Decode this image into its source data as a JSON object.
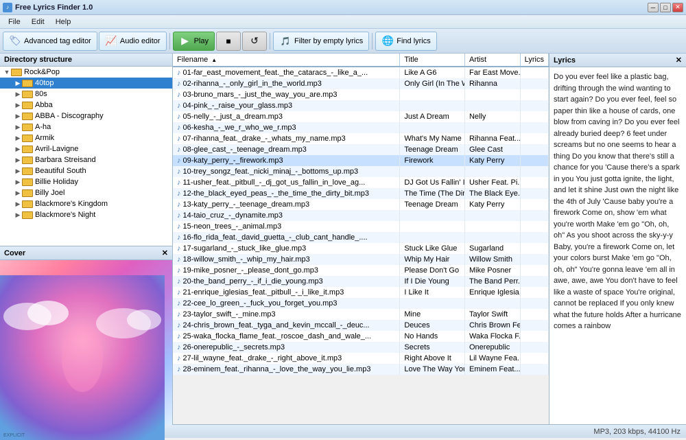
{
  "app": {
    "title": "Free Lyrics Finder 1.0",
    "icon_label": "♪"
  },
  "titlebar": {
    "min_label": "─",
    "max_label": "□",
    "close_label": "✕"
  },
  "menu": {
    "items": [
      {
        "label": "File",
        "id": "file"
      },
      {
        "label": "Edit",
        "id": "edit"
      },
      {
        "label": "Help",
        "id": "help"
      }
    ]
  },
  "toolbar": {
    "tag_editor_label": "Advanced tag editor",
    "audio_editor_label": "Audio editor",
    "play_label": "Play",
    "stop_label": "■",
    "refresh_label": "↺",
    "filter_label": "Filter by empty lyrics",
    "find_lyrics_label": "Find lyrics"
  },
  "left_panel": {
    "header": "Directory structure",
    "tree": [
      {
        "label": "Rock&Pop",
        "level": 0,
        "expanded": true,
        "selected": false
      },
      {
        "label": "40top",
        "level": 1,
        "expanded": false,
        "selected": true
      },
      {
        "label": "80s",
        "level": 1,
        "expanded": false,
        "selected": false
      },
      {
        "label": "Abba",
        "level": 1,
        "expanded": false,
        "selected": false
      },
      {
        "label": "ABBA - Discography",
        "level": 1,
        "expanded": false,
        "selected": false
      },
      {
        "label": "A-ha",
        "level": 1,
        "expanded": false,
        "selected": false
      },
      {
        "label": "Armik",
        "level": 1,
        "expanded": false,
        "selected": false
      },
      {
        "label": "Avril-Lavigne",
        "level": 1,
        "expanded": false,
        "selected": false
      },
      {
        "label": "Barbara Streisand",
        "level": 1,
        "expanded": false,
        "selected": false
      },
      {
        "label": "Beautiful South",
        "level": 1,
        "expanded": false,
        "selected": false
      },
      {
        "label": "Billie Holiday",
        "level": 1,
        "expanded": false,
        "selected": false
      },
      {
        "label": "Billy Joel",
        "level": 1,
        "expanded": false,
        "selected": false
      },
      {
        "label": "Blackmore's Kingdom",
        "level": 1,
        "expanded": false,
        "selected": false
      },
      {
        "label": "Blackmore's Night",
        "level": 1,
        "expanded": false,
        "selected": false
      }
    ]
  },
  "cover": {
    "header": "Cover"
  },
  "file_table": {
    "columns": [
      {
        "label": "Filename",
        "sort": "asc"
      },
      {
        "label": "Title",
        "sort": null
      },
      {
        "label": "Artist",
        "sort": null
      },
      {
        "label": "Lyrics",
        "sort": null
      }
    ],
    "rows": [
      {
        "filename": "01-far_east_movement_feat._the_cataracs_-_like_a_...",
        "title": "Like A G6",
        "artist": "Far East Move...",
        "has_lyrics": true,
        "highlighted": false
      },
      {
        "filename": "02-rihanna_-_only_girl_in_the_world.mp3",
        "title": "Only Girl (In The World)",
        "artist": "Rihanna",
        "has_lyrics": true,
        "highlighted": false
      },
      {
        "filename": "03-bruno_mars_-_just_the_way_you_are.mp3",
        "title": "",
        "artist": "",
        "has_lyrics": false,
        "highlighted": false
      },
      {
        "filename": "04-pink_-_raise_your_glass.mp3",
        "title": "",
        "artist": "",
        "has_lyrics": false,
        "highlighted": false
      },
      {
        "filename": "05-nelly_-_just_a_dream.mp3",
        "title": "Just A Dream",
        "artist": "Nelly",
        "has_lyrics": true,
        "highlighted": false
      },
      {
        "filename": "06-kesha_-_we_r_who_we_r.mp3",
        "title": "",
        "artist": "",
        "has_lyrics": false,
        "highlighted": false
      },
      {
        "filename": "07-rihanna_feat._drake_-_whats_my_name.mp3",
        "title": "What's My Name",
        "artist": "Rihanna Feat....",
        "has_lyrics": true,
        "highlighted": false
      },
      {
        "filename": "08-glee_cast_-_teenage_dream.mp3",
        "title": "Teenage Dream",
        "artist": "Glee Cast",
        "has_lyrics": true,
        "highlighted": false
      },
      {
        "filename": "09-katy_perry_-_firework.mp3",
        "title": "Firework",
        "artist": "Katy Perry",
        "has_lyrics": true,
        "highlighted": true
      },
      {
        "filename": "10-trey_songz_feat._nicki_minaj_-_bottoms_up.mp3",
        "title": "",
        "artist": "",
        "has_lyrics": false,
        "highlighted": false
      },
      {
        "filename": "11-usher_feat._pitbull_-_dj_got_us_fallin_in_love_ag...",
        "title": "DJ Got Us Fallin' In Love A...",
        "artist": "Usher Feat. Pi...",
        "has_lyrics": true,
        "highlighted": false
      },
      {
        "filename": "12-the_black_eyed_peas_-_the_time_the_dirty_bit.mp3",
        "title": "The Time (The Dirty Bit)",
        "artist": "The Black Eye...",
        "has_lyrics": true,
        "highlighted": false
      },
      {
        "filename": "13-katy_perry_-_teenage_dream.mp3",
        "title": "Teenage Dream",
        "artist": "Katy Perry",
        "has_lyrics": true,
        "highlighted": false
      },
      {
        "filename": "14-taio_cruz_-_dynamite.mp3",
        "title": "",
        "artist": "",
        "has_lyrics": false,
        "highlighted": false
      },
      {
        "filename": "15-neon_trees_-_animal.mp3",
        "title": "",
        "artist": "",
        "has_lyrics": false,
        "highlighted": false
      },
      {
        "filename": "16-flo_rida_feat._david_guetta_-_club_cant_handle_....",
        "title": "",
        "artist": "",
        "has_lyrics": false,
        "highlighted": false
      },
      {
        "filename": "17-sugarland_-_stuck_like_glue.mp3",
        "title": "Stuck Like Glue",
        "artist": "Sugarland",
        "has_lyrics": true,
        "highlighted": false
      },
      {
        "filename": "18-willow_smith_-_whip_my_hair.mp3",
        "title": "Whip My Hair",
        "artist": "Willow Smith",
        "has_lyrics": true,
        "highlighted": false
      },
      {
        "filename": "19-mike_posner_-_please_dont_go.mp3",
        "title": "Please Don't Go",
        "artist": "Mike Posner",
        "has_lyrics": true,
        "highlighted": false
      },
      {
        "filename": "20-the_band_perry_-_if_i_die_young.mp3",
        "title": "If I Die Young",
        "artist": "The Band Perr...",
        "has_lyrics": true,
        "highlighted": false
      },
      {
        "filename": "21-enrique_iglesias_feat._pitbull_-_i_like_it.mp3",
        "title": "I Like It",
        "artist": "Enrique Iglesia...",
        "has_lyrics": true,
        "highlighted": false
      },
      {
        "filename": "22-cee_lo_green_-_fuck_you_forget_you.mp3",
        "title": "",
        "artist": "",
        "has_lyrics": false,
        "highlighted": false
      },
      {
        "filename": "23-taylor_swift_-_mine.mp3",
        "title": "Mine",
        "artist": "Taylor Swift",
        "has_lyrics": true,
        "highlighted": false
      },
      {
        "filename": "24-chris_brown_feat._tyga_and_kevin_mccall_-_deuc...",
        "title": "Deuces",
        "artist": "Chris Brown Fe...",
        "has_lyrics": true,
        "highlighted": false
      },
      {
        "filename": "25-waka_flocka_flame_feat._roscoe_dash_and_wale_...",
        "title": "No Hands",
        "artist": "Waka Flocka F...",
        "has_lyrics": true,
        "highlighted": false
      },
      {
        "filename": "26-onerepublic_-_secrets.mp3",
        "title": "Secrets",
        "artist": "Onerepublic",
        "has_lyrics": true,
        "highlighted": false
      },
      {
        "filename": "27-lil_wayne_feat._drake_-_right_above_it.mp3",
        "title": "Right Above It",
        "artist": "Lil Wayne Fea...",
        "has_lyrics": true,
        "highlighted": false
      },
      {
        "filename": "28-eminem_feat._rihanna_-_love_the_way_you_lie.mp3",
        "title": "Love The Way You Lie",
        "artist": "Eminem Feat....",
        "has_lyrics": true,
        "highlighted": false
      }
    ]
  },
  "lyrics": {
    "header": "Lyrics",
    "content": "Do you ever feel like a plastic bag,\ndrifting through the wind\nwanting to start again?\nDo you ever feel, feel so paper thin\nlike a house of cards,\none blow from caving in?\n\nDo you ever feel already buried deep?\n6 feet under screams but no one\nseems to hear a thing\nDo you know that there's still a\nchance for you\n'Cause there's a spark in you\n\nYou just gotta ignite, the light, and let\nit shine\nJust own the night like the 4th of July\n\n'Cause baby you're a firework\nCome on, show 'em what you're\nworth\nMake 'em go \"Oh, oh, oh\"\nAs you shoot across the sky-y-y\n\nBaby, you're a firework\nCome on, let your colors burst\nMake 'em go \"Oh, oh, oh\"\nYou're gonna leave 'em all in awe,\nawe, awe\n\nYou don't have to feel like a waste of\nspace\nYou're original, cannot be replaced\nIf you only knew what the future\nholds\nAfter a hurricane comes a rainbow"
  },
  "statusbar": {
    "text": "MP3, 203 kbps, 44100 Hz"
  },
  "colors": {
    "accent": "#3080d0",
    "selected_row": "#c8e0ff",
    "header_bg": "#e0ecf8"
  }
}
